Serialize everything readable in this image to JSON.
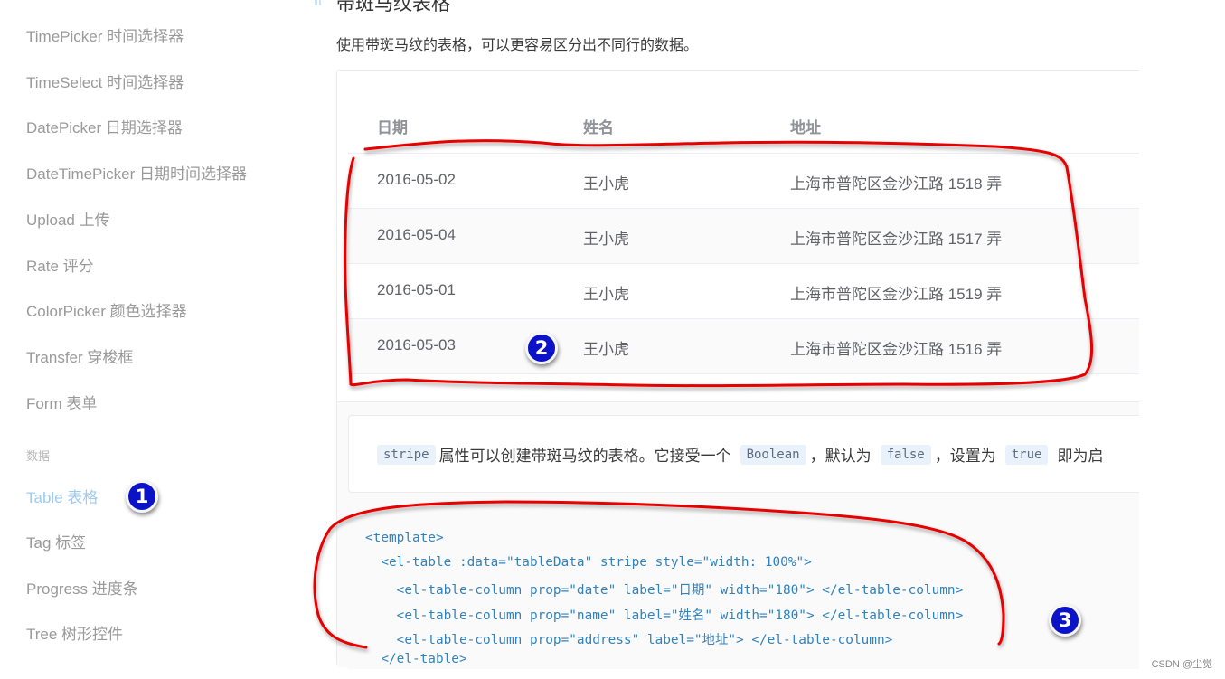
{
  "sidebar": {
    "items": [
      {
        "label": "TimePicker 时间选择器"
      },
      {
        "label": "TimeSelect 时间选择器"
      },
      {
        "label": "DatePicker 日期选择器"
      },
      {
        "label": "DateTimePicker 日期时间选择器"
      },
      {
        "label": "Upload 上传"
      },
      {
        "label": "Rate 评分"
      },
      {
        "label": "ColorPicker 颜色选择器"
      },
      {
        "label": "Transfer 穿梭框"
      },
      {
        "label": "Form 表单"
      }
    ],
    "group_label": "数据",
    "data_items": [
      {
        "label": "Table 表格",
        "active": true
      },
      {
        "label": "Tag 标签"
      },
      {
        "label": "Progress 进度条"
      },
      {
        "label": "Tree 树形控件"
      }
    ]
  },
  "main": {
    "section_title": "带斑马纹表格",
    "description": "使用带斑马纹的表格，可以更容易区分出不同行的数据。",
    "table": {
      "columns": [
        "日期",
        "姓名",
        "地址"
      ],
      "rows": [
        {
          "date": "2016-05-02",
          "name": "王小虎",
          "address": "上海市普陀区金沙江路 1518 弄"
        },
        {
          "date": "2016-05-04",
          "name": "王小虎",
          "address": "上海市普陀区金沙江路 1517 弄"
        },
        {
          "date": "2016-05-01",
          "name": "王小虎",
          "address": "上海市普陀区金沙江路 1519 弄"
        },
        {
          "date": "2016-05-03",
          "name": "王小虎",
          "address": "上海市普陀区金沙江路 1516 弄"
        }
      ]
    },
    "meta_description": {
      "code_stripe": "stripe",
      "text1": "属性可以创建带斑马纹的表格。它接受一个",
      "code_boolean": "Boolean",
      "sep1": "，默认为",
      "code_false": "false",
      "sep2": "，设置为",
      "code_true": "true",
      "text2": "即为启"
    },
    "code_lines": [
      "<template>",
      "  <el-table :data=\"tableData\" stripe style=\"width: 100%\">",
      "    <el-table-column prop=\"date\" label=\"日期\" width=\"180\"> </el-table-column>",
      "    <el-table-column prop=\"name\" label=\"姓名\" width=\"180\"> </el-table-column>",
      "    <el-table-column prop=\"address\" label=\"地址\"> </el-table-column>",
      "  </el-table>"
    ]
  },
  "annotations": {
    "badge1": "1",
    "badge2": "2",
    "badge3": "3",
    "marker_color": "#e60000",
    "badge_color": "#0b12c7"
  },
  "watermark": "CSDN @尘觉"
}
